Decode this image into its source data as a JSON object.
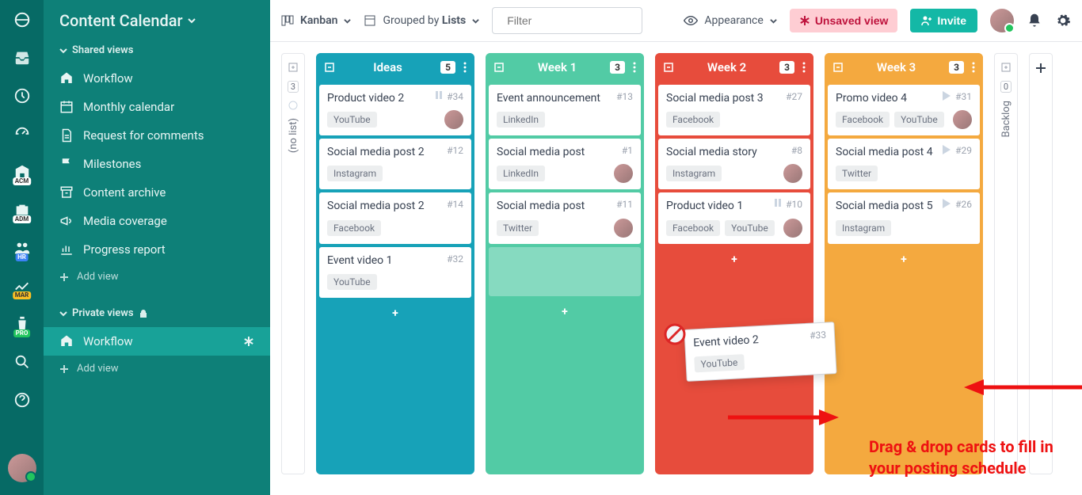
{
  "sidebar": {
    "title": "Content Calendar",
    "shared_label": "Shared views",
    "items": [
      {
        "icon": "home",
        "label": "Workflow"
      },
      {
        "icon": "calendar",
        "label": "Monthly calendar"
      },
      {
        "icon": "file",
        "label": "Request for comments"
      },
      {
        "icon": "flag",
        "label": "Milestones"
      },
      {
        "icon": "archive",
        "label": "Content archive"
      },
      {
        "icon": "megaphone",
        "label": "Media coverage"
      },
      {
        "icon": "chart",
        "label": "Progress report"
      }
    ],
    "add_view": "Add view",
    "private_label": "Private views",
    "private_items": [
      {
        "icon": "home",
        "label": "Workflow",
        "active": true
      }
    ]
  },
  "rail": {
    "badges": [
      "ACM",
      "ADM",
      "HR",
      "MAR",
      "PRO"
    ]
  },
  "topbar": {
    "view_type": "Kanban",
    "grouped_by_prefix": "Grouped by ",
    "grouped_by_value": "Lists",
    "filter_placeholder": "Filter",
    "appearance": "Appearance",
    "unsaved": "Unsaved view",
    "invite": "Invite"
  },
  "board": {
    "nolist": {
      "label": "(no list)",
      "count": "3"
    },
    "backlog": {
      "label": "Backlog",
      "count": "0"
    },
    "columns": [
      {
        "color": "teal",
        "title": "Ideas",
        "count": "5",
        "cards": [
          {
            "title": "Product video 2",
            "id": "#34",
            "tags": [
              "YouTube"
            ],
            "avatar": true,
            "pause": true
          },
          {
            "title": "Social media post 2",
            "id": "#12",
            "tags": [
              "Instagram"
            ]
          },
          {
            "title": "Social media post 2",
            "id": "#14",
            "tags": [
              "Facebook"
            ]
          },
          {
            "title": "Event video 1",
            "id": "#32",
            "tags": [
              "YouTube"
            ]
          }
        ]
      },
      {
        "color": "mint",
        "title": "Week 1",
        "count": "3",
        "cards": [
          {
            "title": "Event announcement",
            "id": "#13",
            "tags": [
              "LinkedIn"
            ]
          },
          {
            "title": "Social media post",
            "id": "#1",
            "tags": [
              "LinkedIn"
            ],
            "avatar": true
          },
          {
            "title": "Social media post",
            "id": "#11",
            "tags": [
              "Twitter"
            ],
            "avatar": true
          }
        ],
        "placeholder": true
      },
      {
        "color": "red",
        "title": "Week 2",
        "count": "3",
        "cards": [
          {
            "title": "Social media post 3",
            "id": "#27",
            "tags": [
              "Facebook"
            ]
          },
          {
            "title": "Social media story",
            "id": "#8",
            "tags": [
              "Instagram"
            ],
            "avatar": true
          },
          {
            "title": "Product video 1",
            "id": "#10",
            "tags": [
              "Facebook",
              "YouTube"
            ],
            "avatar": true,
            "pause": true
          }
        ]
      },
      {
        "color": "orange",
        "title": "Week 3",
        "count": "3",
        "cards": [
          {
            "title": "Promo video 4",
            "id": "#31",
            "tags": [
              "Facebook",
              "YouTube"
            ],
            "avatar": true,
            "play": true
          },
          {
            "title": "Social media post 4",
            "id": "#29",
            "tags": [
              "Twitter"
            ],
            "play": true
          },
          {
            "title": "Social media post 5",
            "id": "#26",
            "tags": [
              "Instagram"
            ],
            "play": true
          }
        ]
      }
    ]
  },
  "dragging": {
    "title": "Event video 2",
    "id": "#33",
    "tags": [
      "YouTube"
    ]
  },
  "annotation": {
    "line1": "Drag & drop cards to fill in",
    "line2": "your posting schedule"
  }
}
